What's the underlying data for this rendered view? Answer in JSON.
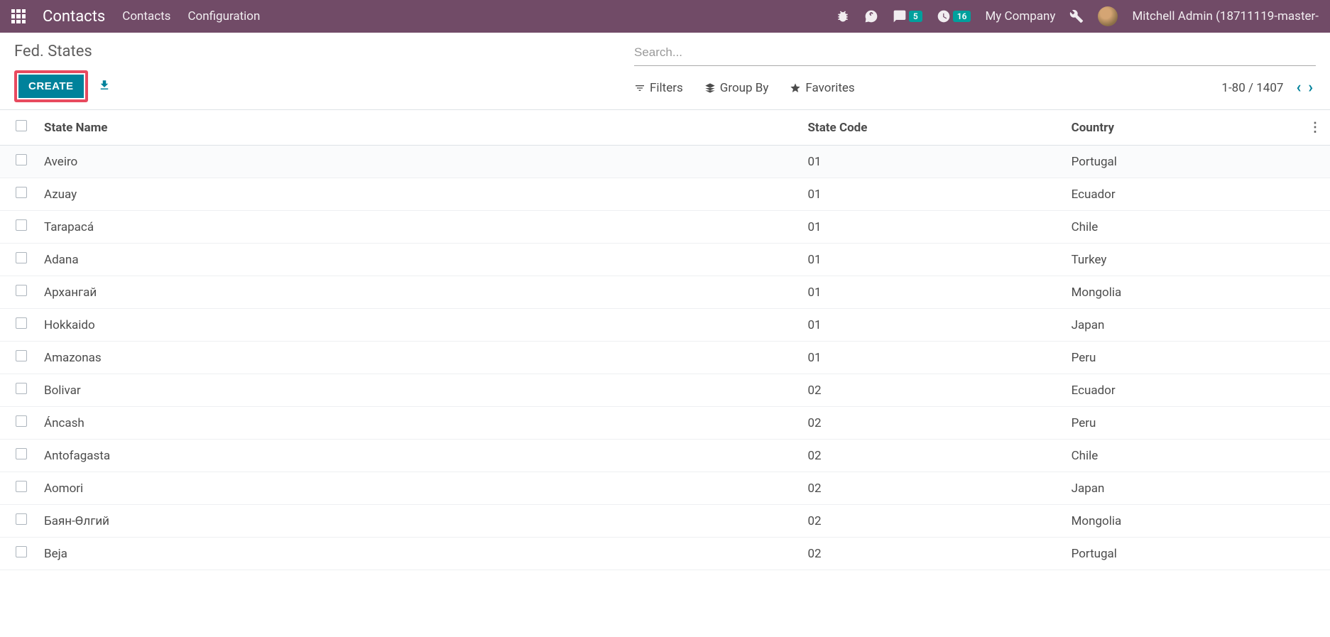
{
  "navbar": {
    "app_title": "Contacts",
    "links": [
      "Contacts",
      "Configuration"
    ],
    "messages_badge": "5",
    "activities_badge": "16",
    "company": "My Company",
    "user": "Mitchell Admin (18711119-master-"
  },
  "control_panel": {
    "breadcrumb": "Fed. States",
    "create_label": "CREATE",
    "search_placeholder": "Search...",
    "filters_label": "Filters",
    "groupby_label": "Group By",
    "favorites_label": "Favorites",
    "pager_range": "1-80",
    "pager_sep": " / ",
    "pager_total": "1407"
  },
  "table": {
    "headers": {
      "name": "State Name",
      "code": "State Code",
      "country": "Country"
    },
    "rows": [
      {
        "name": "Aveiro",
        "code": "01",
        "country": "Portugal"
      },
      {
        "name": "Azuay",
        "code": "01",
        "country": "Ecuador"
      },
      {
        "name": "Tarapacá",
        "code": "01",
        "country": "Chile"
      },
      {
        "name": "Adana",
        "code": "01",
        "country": "Turkey"
      },
      {
        "name": "Архангай",
        "code": "01",
        "country": "Mongolia"
      },
      {
        "name": "Hokkaido",
        "code": "01",
        "country": "Japan"
      },
      {
        "name": "Amazonas",
        "code": "01",
        "country": "Peru"
      },
      {
        "name": "Bolivar",
        "code": "02",
        "country": "Ecuador"
      },
      {
        "name": "Áncash",
        "code": "02",
        "country": "Peru"
      },
      {
        "name": "Antofagasta",
        "code": "02",
        "country": "Chile"
      },
      {
        "name": "Aomori",
        "code": "02",
        "country": "Japan"
      },
      {
        "name": "Баян-Өлгий",
        "code": "02",
        "country": "Mongolia"
      },
      {
        "name": "Beja",
        "code": "02",
        "country": "Portugal"
      }
    ]
  }
}
